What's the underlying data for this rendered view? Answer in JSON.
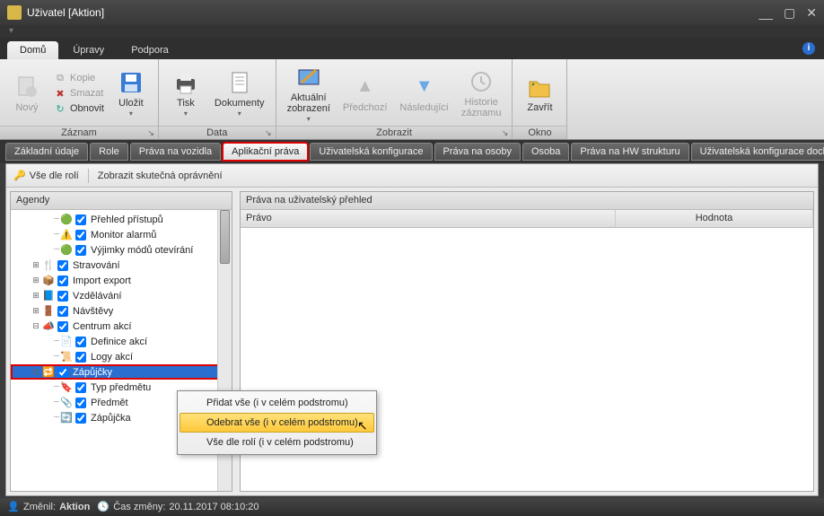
{
  "window": {
    "title": "Uživatel [Aktion]"
  },
  "menu_tabs": [
    {
      "label": "Domů",
      "active": true
    },
    {
      "label": "Úpravy",
      "active": false
    },
    {
      "label": "Podpora",
      "active": false
    }
  ],
  "ribbon": {
    "groups": [
      {
        "label": "Záznam",
        "big": [
          {
            "name": "novy",
            "label": "Nový",
            "icon": "new",
            "disabled": true
          }
        ],
        "small": [
          {
            "name": "kopie",
            "label": "Kopie",
            "icon": "copy",
            "disabled": true
          },
          {
            "name": "smazat",
            "label": "Smazat",
            "icon": "delete",
            "disabled": true
          },
          {
            "name": "obnovit",
            "label": "Obnovit",
            "icon": "refresh",
            "disabled": false
          }
        ],
        "big2": [
          {
            "name": "ulozit",
            "label": "Uložit",
            "icon": "save",
            "disabled": false,
            "drop": true
          }
        ]
      },
      {
        "label": "Data",
        "big": [
          {
            "name": "tisk",
            "label": "Tisk",
            "icon": "print",
            "drop": true
          },
          {
            "name": "dokumenty",
            "label": "Dokumenty",
            "icon": "doc",
            "drop": true
          }
        ]
      },
      {
        "label": "Zobrazit",
        "big": [
          {
            "name": "aktualni",
            "label": "Aktuální\nzobrazení",
            "icon": "view",
            "drop": true
          },
          {
            "name": "predchozi",
            "label": "Předchozí",
            "icon": "prev",
            "disabled": true
          },
          {
            "name": "nasledujici",
            "label": "Následující",
            "icon": "next",
            "disabled": true
          },
          {
            "name": "historie",
            "label": "Historie\nzáznamu",
            "icon": "hist",
            "disabled": true
          }
        ]
      },
      {
        "label": "Okno",
        "big": [
          {
            "name": "zavrit",
            "label": "Zavřít",
            "icon": "folder"
          }
        ]
      }
    ]
  },
  "subtabs": [
    {
      "label": "Základní údaje"
    },
    {
      "label": "Role"
    },
    {
      "label": "Práva na vozidla"
    },
    {
      "label": "Aplikační práva",
      "active": true,
      "highlight": true
    },
    {
      "label": "Uživatelská konfigurace"
    },
    {
      "label": "Práva na osoby"
    },
    {
      "label": "Osoba"
    },
    {
      "label": "Práva na HW strukturu"
    },
    {
      "label": "Uživatelská konfigurace docha"
    }
  ],
  "toolbar2": {
    "vse_dle_roli": "Vše dle rolí",
    "zobrazit": "Zobrazit skutečná oprávnění"
  },
  "left_panel": {
    "title": "Agendy",
    "tree": [
      {
        "lvl": 3,
        "label": "Přehled přístupů",
        "checked": true,
        "icon": "green"
      },
      {
        "lvl": 3,
        "label": "Monitor alarmů",
        "checked": true,
        "icon": "warn"
      },
      {
        "lvl": 3,
        "label": "Výjimky módů otevírání",
        "checked": true,
        "icon": "green"
      },
      {
        "lvl": 2,
        "label": "Stravování",
        "checked": true,
        "exp": "+",
        "icon": "cutlery"
      },
      {
        "lvl": 2,
        "label": "Import export",
        "checked": true,
        "exp": "+",
        "icon": "box"
      },
      {
        "lvl": 2,
        "label": "Vzdělávání",
        "checked": true,
        "exp": "+",
        "icon": "book"
      },
      {
        "lvl": 2,
        "label": "Návštěvy",
        "checked": true,
        "exp": "+",
        "icon": "visit"
      },
      {
        "lvl": 2,
        "label": "Centrum akcí",
        "checked": true,
        "exp": "−",
        "icon": "center"
      },
      {
        "lvl": 3,
        "label": "Definice akcí",
        "checked": true,
        "icon": "def"
      },
      {
        "lvl": 3,
        "label": "Logy akcí",
        "checked": true,
        "icon": "log"
      },
      {
        "lvl": 2,
        "label": "Zápůjčky",
        "checked": true,
        "exp": "−",
        "icon": "loan",
        "selected": true,
        "highlight": true
      },
      {
        "lvl": 3,
        "label": "Typ předmětu",
        "checked": true,
        "icon": "type"
      },
      {
        "lvl": 3,
        "label": "Předmět",
        "checked": true,
        "icon": "item"
      },
      {
        "lvl": 3,
        "label": "Zápůjčka",
        "checked": true,
        "icon": "loan2"
      }
    ]
  },
  "right_panel": {
    "title": "Práva na uživatelský přehled",
    "columns": {
      "pravo": "Právo",
      "hodnota": "Hodnota"
    }
  },
  "context_menu": {
    "items": [
      {
        "label": "Přidat vše (i v celém podstromu)"
      },
      {
        "label": "Odebrat vše (i v celém podstromu)",
        "hover": true
      },
      {
        "label": "Vše dle rolí (i v celém podstromu)"
      }
    ]
  },
  "status": {
    "changed_label": "Změnil:",
    "changed_value": "Aktion",
    "time_label": "Čas změny:",
    "time_value": "20.11.2017 08:10:20"
  }
}
